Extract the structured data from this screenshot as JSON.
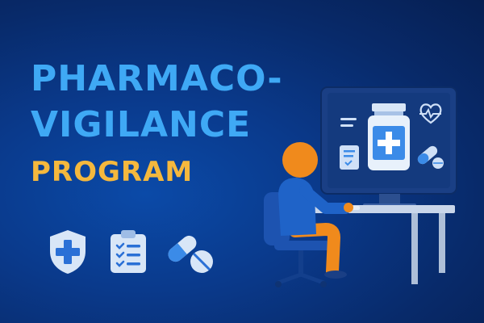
{
  "title": {
    "line1": "PHARMACO-",
    "line2": "VIGILANCE",
    "line3": "PROGRAM"
  },
  "icons": [
    "shield-cross-icon",
    "clipboard-checklist-icon",
    "capsule-pill-icon"
  ],
  "illustration": {
    "screen_icons": [
      "menu-lines-icon",
      "heart-pulse-icon",
      "document-check-icon",
      "medicine-bottle-icon",
      "capsule-pill-icon"
    ]
  },
  "colors": {
    "title_blue": "#3fa9f5",
    "title_orange": "#f5b83d",
    "background": "#0a3a8c",
    "person_orange": "#f08a1c",
    "person_shirt": "#1f63c8"
  }
}
